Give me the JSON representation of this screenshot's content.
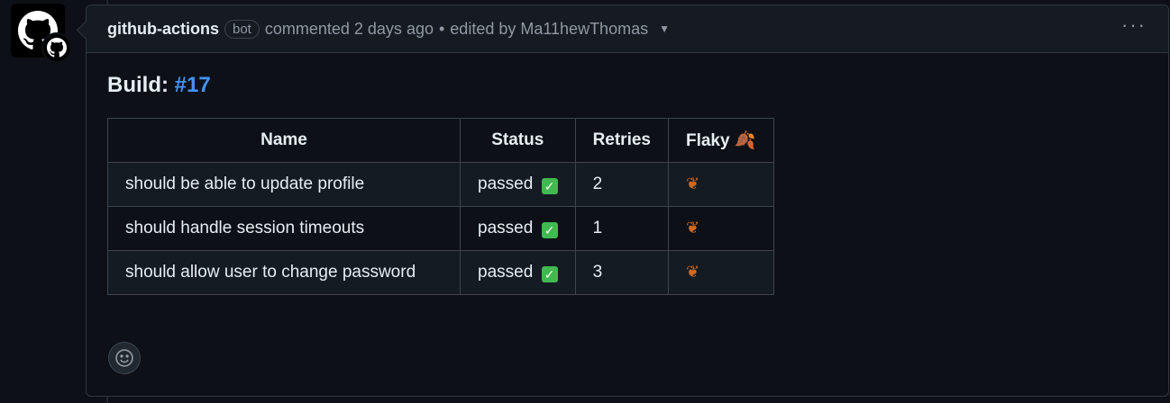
{
  "comment": {
    "author": "github-actions",
    "badge": "bot",
    "action": "commented 2 days ago",
    "separator": "•",
    "edited": "edited by Ma11hewThomas",
    "more": "···"
  },
  "build": {
    "label": "Build:",
    "link": "#17"
  },
  "table": {
    "headers": [
      "Name",
      "Status",
      "Retries",
      "Flaky 🍂"
    ],
    "rows": [
      {
        "name": "should be able to update profile",
        "status": "passed",
        "status_icon": "✅",
        "retries": "2",
        "flaky": "🍂"
      },
      {
        "name": "should handle session timeouts",
        "status": "passed",
        "status_icon": "✅",
        "retries": "1",
        "flaky": "🍂"
      },
      {
        "name": "should allow user to change password",
        "status": "passed",
        "status_icon": "✅",
        "retries": "3",
        "flaky": "🍂"
      }
    ]
  },
  "icons": {
    "avatar": "github-octocat-icon",
    "avatar_badge": "github-app-icon",
    "reaction": "smiley-icon",
    "caret": "chevron-down-icon",
    "check": "check-mark-icon",
    "leaf": "fallen-leaf-icon"
  },
  "colors": {
    "background": "#0d1117",
    "header": "#161b22",
    "border": "#30363d",
    "link": "#4493f8",
    "muted": "#9198a1",
    "success": "#3fb950"
  }
}
